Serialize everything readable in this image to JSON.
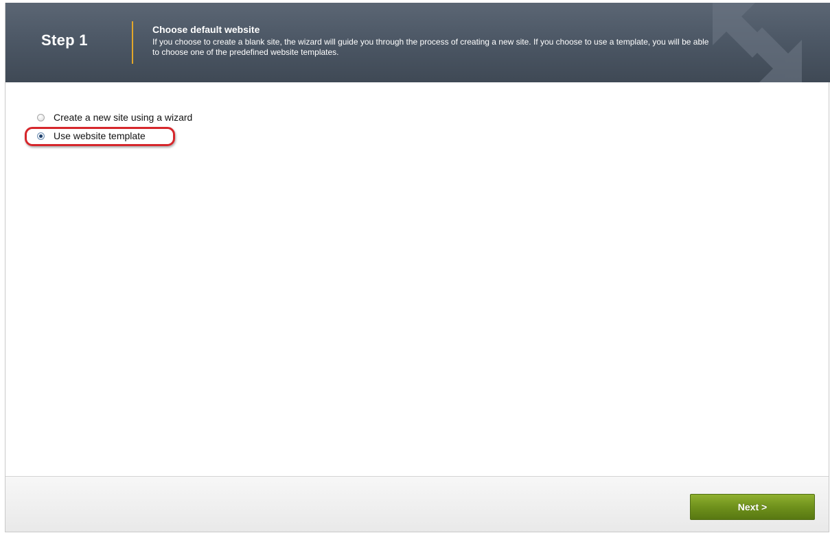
{
  "header": {
    "step_label": "Step 1",
    "title": "Choose default website",
    "description": "If you choose to create a blank site, the wizard will guide you through the process of creating a new site. If you choose to use a template, you will be able to choose one of the predefined website templates.",
    "decoration_icon": "resize-arrows-icon"
  },
  "options": [
    {
      "label": "Create a new site using a wizard",
      "selected": false
    },
    {
      "label": "Use website template",
      "selected": true
    }
  ],
  "annotation": {
    "highlight_color": "#d6262b",
    "target": "Use website template"
  },
  "footer": {
    "next_label": "Next >"
  },
  "colors": {
    "header_bg": "#4d5866",
    "divider_accent": "#e3a72a",
    "next_button": "#6f911c"
  }
}
